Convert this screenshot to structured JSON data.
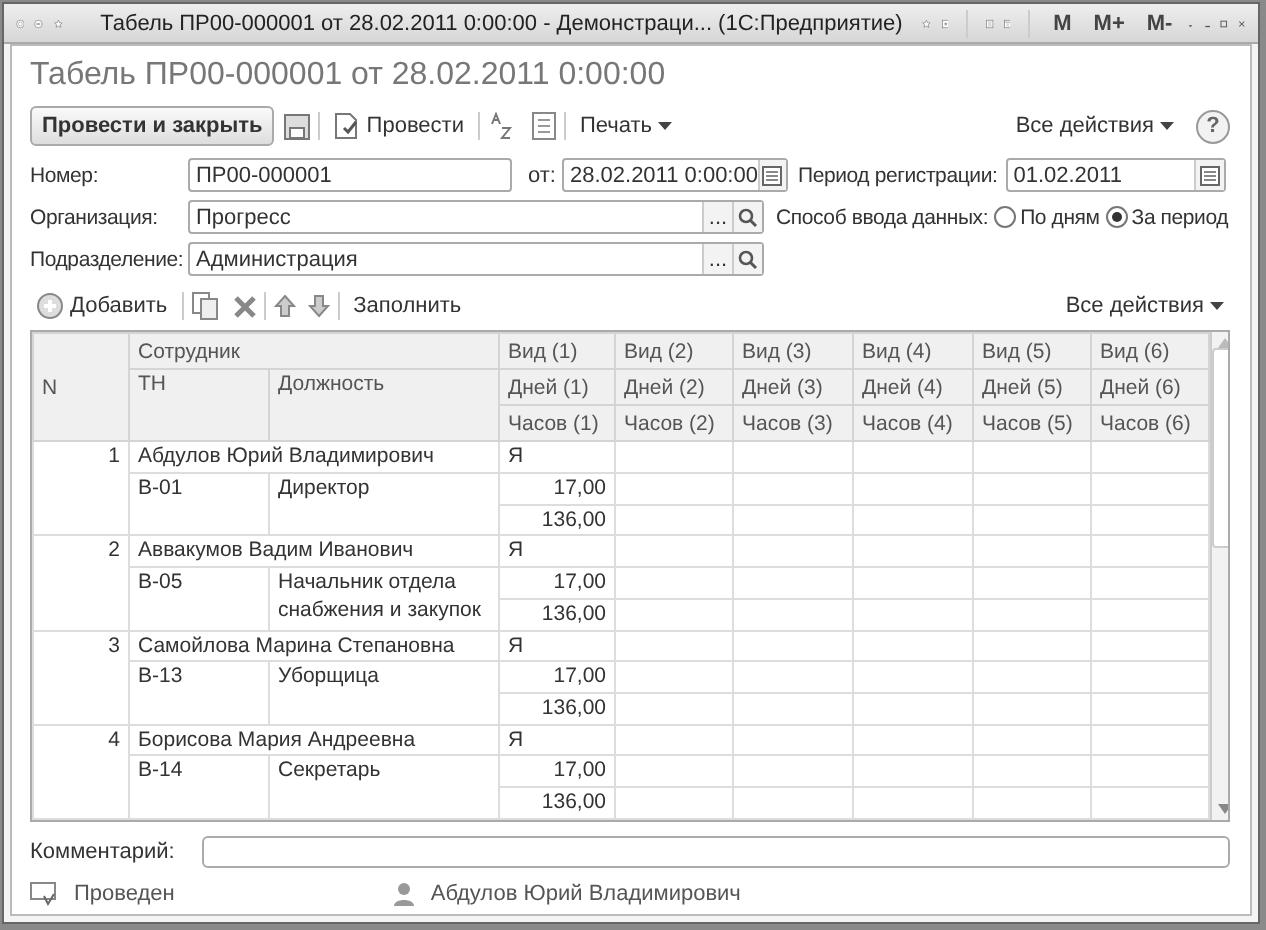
{
  "window": {
    "title": "Табель ПР00-000001 от 28.02.2011 0:00:00 - Демонстраци... (1С:Предприятие)",
    "memory_buttons": [
      "M",
      "M+",
      "M-"
    ]
  },
  "document_title": "Табель ПР00-000001 от 28.02.2011 0:00:00",
  "toolbar": {
    "post_and_close": "Провести и закрыть",
    "post": "Провести",
    "print": "Печать",
    "all_actions": "Все действия",
    "help": "?"
  },
  "fields": {
    "number": {
      "label": "Номер:",
      "value": "ПР00-000001"
    },
    "date": {
      "label": "от:",
      "value": "28.02.2011  0:00:00"
    },
    "period": {
      "label": "Период регистрации:",
      "value": "01.02.2011"
    },
    "organization": {
      "label": "Организация:",
      "value": "Прогресс",
      "choose_button": "..."
    },
    "department": {
      "label": "Подразделение:",
      "value": "Администрация",
      "choose_button": "..."
    },
    "input_mode": {
      "label": "Способ ввода данных:",
      "options": [
        {
          "label": "По дням",
          "selected": false
        },
        {
          "label": "За период",
          "selected": true
        }
      ]
    }
  },
  "table_toolbar": {
    "add": "Добавить",
    "fill": "Заполнить",
    "all_actions": "Все действия"
  },
  "table": {
    "columns": {
      "n": "N",
      "employee": "Сотрудник",
      "tn": "ТН",
      "position": "Должность",
      "kinds": [
        {
          "kind": "Вид (1)",
          "days": "Дней (1)",
          "hours": "Часов (1)"
        },
        {
          "kind": "Вид (2)",
          "days": "Дней (2)",
          "hours": "Часов (2)"
        },
        {
          "kind": "Вид (3)",
          "days": "Дней (3)",
          "hours": "Часов (3)"
        },
        {
          "kind": "Вид (4)",
          "days": "Дней (4)",
          "hours": "Часов (4)"
        },
        {
          "kind": "Вид (5)",
          "days": "Дней (5)",
          "hours": "Часов (5)"
        },
        {
          "kind": "Вид (6)",
          "days": "Дней (6)",
          "hours": "Часов (6)"
        }
      ]
    },
    "rows": [
      {
        "n": "1",
        "name": "Абдулов Юрий Владимирович",
        "tn": "В-01",
        "position": "Директор",
        "values": [
          {
            "kind": "Я",
            "days": "17,00",
            "hours": "136,00"
          }
        ]
      },
      {
        "n": "2",
        "name": "Аввакумов Вадим Иванович",
        "tn": "В-05",
        "position": "Начальник отдела снабжения и закупок",
        "values": [
          {
            "kind": "Я",
            "days": "17,00",
            "hours": "136,00"
          }
        ]
      },
      {
        "n": "3",
        "name": "Самойлова Марина Степановна",
        "tn": "В-13",
        "position": "Уборщица",
        "values": [
          {
            "kind": "Я",
            "days": "17,00",
            "hours": "136,00"
          }
        ]
      },
      {
        "n": "4",
        "name": "Борисова Мария Андреевна",
        "tn": "В-14",
        "position": "Секретарь",
        "values": [
          {
            "kind": "Я",
            "days": "17,00",
            "hours": "136,00"
          }
        ]
      }
    ]
  },
  "comment": {
    "label": "Комментарий:"
  },
  "footer": {
    "status": "Проведен",
    "author": "Абдулов Юрий Владимирович"
  }
}
